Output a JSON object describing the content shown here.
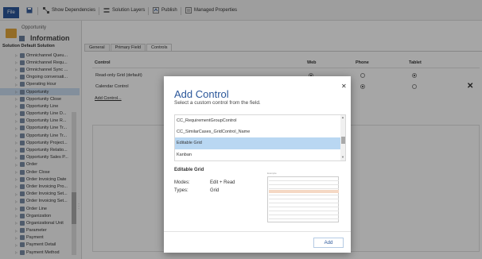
{
  "toolbar": {
    "file_label": "File",
    "save_icon": "save-icon",
    "show_dependencies_label": "Show Dependencies",
    "solution_layers_label": "Solution Layers",
    "publish_label": "Publish",
    "managed_properties_label": "Managed Properties"
  },
  "entity": {
    "name": "Opportunity",
    "subtitle": "Information"
  },
  "solution_label": "Solution Default Solution",
  "tree_items": [
    "Omnichannel Queu...",
    "Omnichannel Requ...",
    "Omnichannel Sync ...",
    "Ongoing conversati...",
    "Operating Hour",
    "Opportunity",
    "Opportunity Close",
    "Opportunity Line",
    "Opportunity Line D...",
    "Opportunity Line R...",
    "Opportunity Line Tr...",
    "Opportunity Line Tr...",
    "Opportunity Project...",
    "Opportunity Relatio...",
    "Opportunity Sales P...",
    "Order",
    "Order Close",
    "Order Invoicing Date",
    "Order Invoicing Pro...",
    "Order Invoicing Set...",
    "Order Invoicing Set...",
    "Order Line",
    "Organization",
    "Organizational Unit",
    "Parameter",
    "Payment",
    "Payment Detail",
    "Payment Method"
  ],
  "selected_tree_index": 5,
  "tabs": [
    {
      "label": "General"
    },
    {
      "label": "Primary Field"
    },
    {
      "label": "Controls"
    }
  ],
  "active_tab": 2,
  "grid": {
    "headers": {
      "control": "Control",
      "web": "Web",
      "phone": "Phone",
      "tablet": "Tablet"
    },
    "rows": [
      {
        "label": "Read-only Grid (default)",
        "web": true,
        "phone": false,
        "tablet": true
      },
      {
        "label": "Calendar Control",
        "web": true,
        "phone": true,
        "tablet": false
      }
    ],
    "add_control_link": "Add Control..."
  },
  "dialog": {
    "title": "Add Control",
    "subtitle": "Select a custom control from the field.",
    "items": [
      "CC_RequirementGroupControl",
      "CC_SimilarCases_GridControl_Name",
      "Editable Grid",
      "Kanban"
    ],
    "selected_index": 2,
    "detail": {
      "name": "Editable Grid",
      "modes_label": "Modes:",
      "modes_value": "Edit + Read",
      "types_label": "Types:",
      "types_value": "Grid",
      "preview_caption": "Example"
    },
    "add_button": "Add"
  }
}
